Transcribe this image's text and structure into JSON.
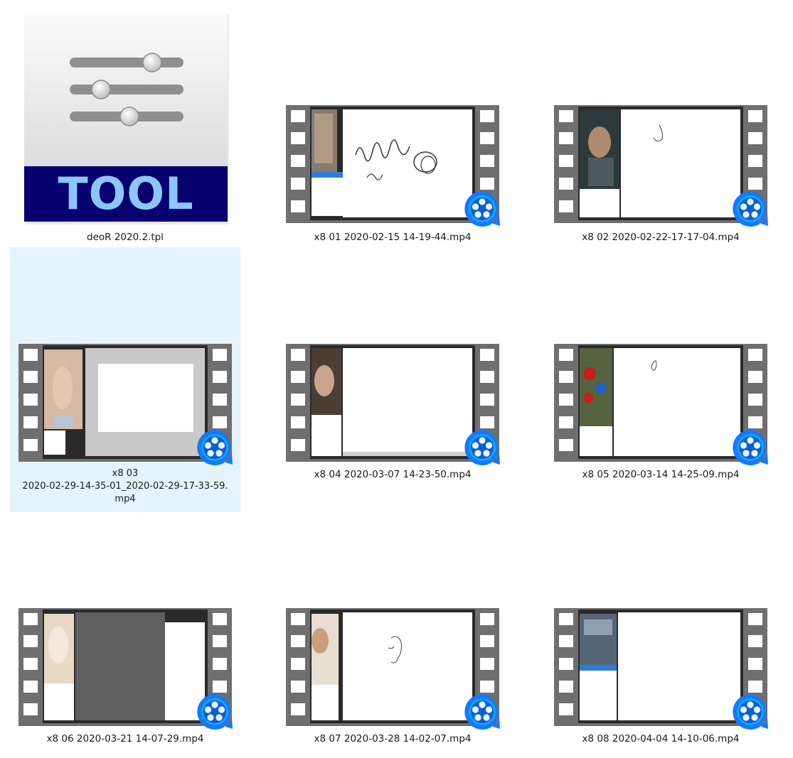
{
  "window": {
    "view": "Large icons",
    "selected_index": 3
  },
  "files": [
    {
      "name": "deoR 2020.2.tpl",
      "type": "tool-template",
      "icon": "tool-file-icon",
      "badge_text": "TOOL",
      "badge_color": "#07006e",
      "badge_text_color": "#8cc6ff"
    },
    {
      "name": "x8 01 2020-02-15 14-19-44.mp4",
      "type": "video",
      "icon": "video-file-icon",
      "thumbnail": "drawing-app-scribble"
    },
    {
      "name": "x8 02 2020-02-22-17-17-04.mp4",
      "type": "video",
      "icon": "video-file-icon",
      "thumbnail": "drawing-app-sketch"
    },
    {
      "name": "x8 03\n2020-02-29-14-35-01_2020-02-29-17-33-59.\nmp4",
      "type": "video",
      "icon": "video-file-icon",
      "thumbnail": "drawing-app-gray-canvas",
      "selected": true
    },
    {
      "name": "x8 04 2020-03-07 14-23-50.mp4",
      "type": "video",
      "icon": "video-file-icon",
      "thumbnail": "drawing-app-blank"
    },
    {
      "name": "x8 05 2020-03-14 14-25-09.mp4",
      "type": "video",
      "icon": "video-file-icon",
      "thumbnail": "drawing-app-flowers"
    },
    {
      "name": "x8 06 2020-03-21 14-07-29.mp4",
      "type": "video",
      "icon": "video-file-icon",
      "thumbnail": "drawing-app-dark-canvas"
    },
    {
      "name": "x8 07 2020-03-28 14-02-07.mp4",
      "type": "video",
      "icon": "video-file-icon",
      "thumbnail": "drawing-app-face-sketch"
    },
    {
      "name": "x8 08 2020-04-04 14-10-06.mp4",
      "type": "video",
      "icon": "video-file-icon",
      "thumbnail": "drawing-app-room"
    }
  ],
  "colors": {
    "selection_bg": "#e5f3ff",
    "film_frame": "#6f6f6f",
    "film_holes": "#ffffff",
    "player_badge": "#1479ff",
    "player_badge_inner": "#12a8ff"
  }
}
